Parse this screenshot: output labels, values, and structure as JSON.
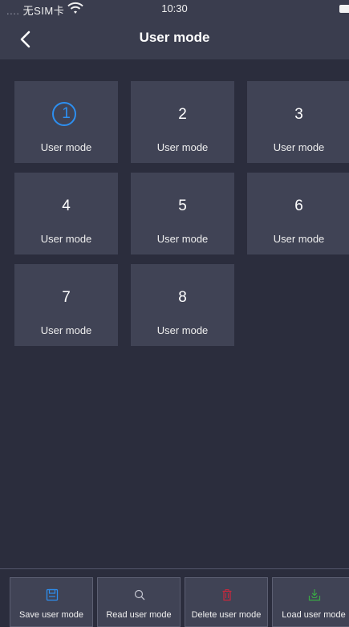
{
  "status_bar": {
    "dots": "....",
    "carrier": "无SIM卡",
    "time": "10:30"
  },
  "nav": {
    "title": "User mode"
  },
  "modes": [
    {
      "number": "1",
      "label": "User mode",
      "selected": true
    },
    {
      "number": "2",
      "label": "User mode",
      "selected": false
    },
    {
      "number": "3",
      "label": "User mode",
      "selected": false
    },
    {
      "number": "4",
      "label": "User mode",
      "selected": false
    },
    {
      "number": "5",
      "label": "User mode",
      "selected": false
    },
    {
      "number": "6",
      "label": "User mode",
      "selected": false
    },
    {
      "number": "7",
      "label": "User mode",
      "selected": false
    },
    {
      "number": "8",
      "label": "User mode",
      "selected": false
    }
  ],
  "toolbar": {
    "save_label": "Save user mode",
    "read_label": "Read user mode",
    "delete_label": "Delete user mode",
    "load_label": "Load user mode"
  },
  "icons": {
    "back": "chevron-left-icon",
    "wifi": "wifi-icon",
    "battery": "battery-icon",
    "save": "floppy-disk-icon",
    "read": "magnifier-icon",
    "delete": "trash-icon",
    "load": "tray-download-icon"
  },
  "colors": {
    "accent_blue": "#2d8ff0",
    "delete_red": "#c8283c",
    "load_green": "#3aa845",
    "background": "#2b2d3d",
    "tile": "#404355"
  }
}
